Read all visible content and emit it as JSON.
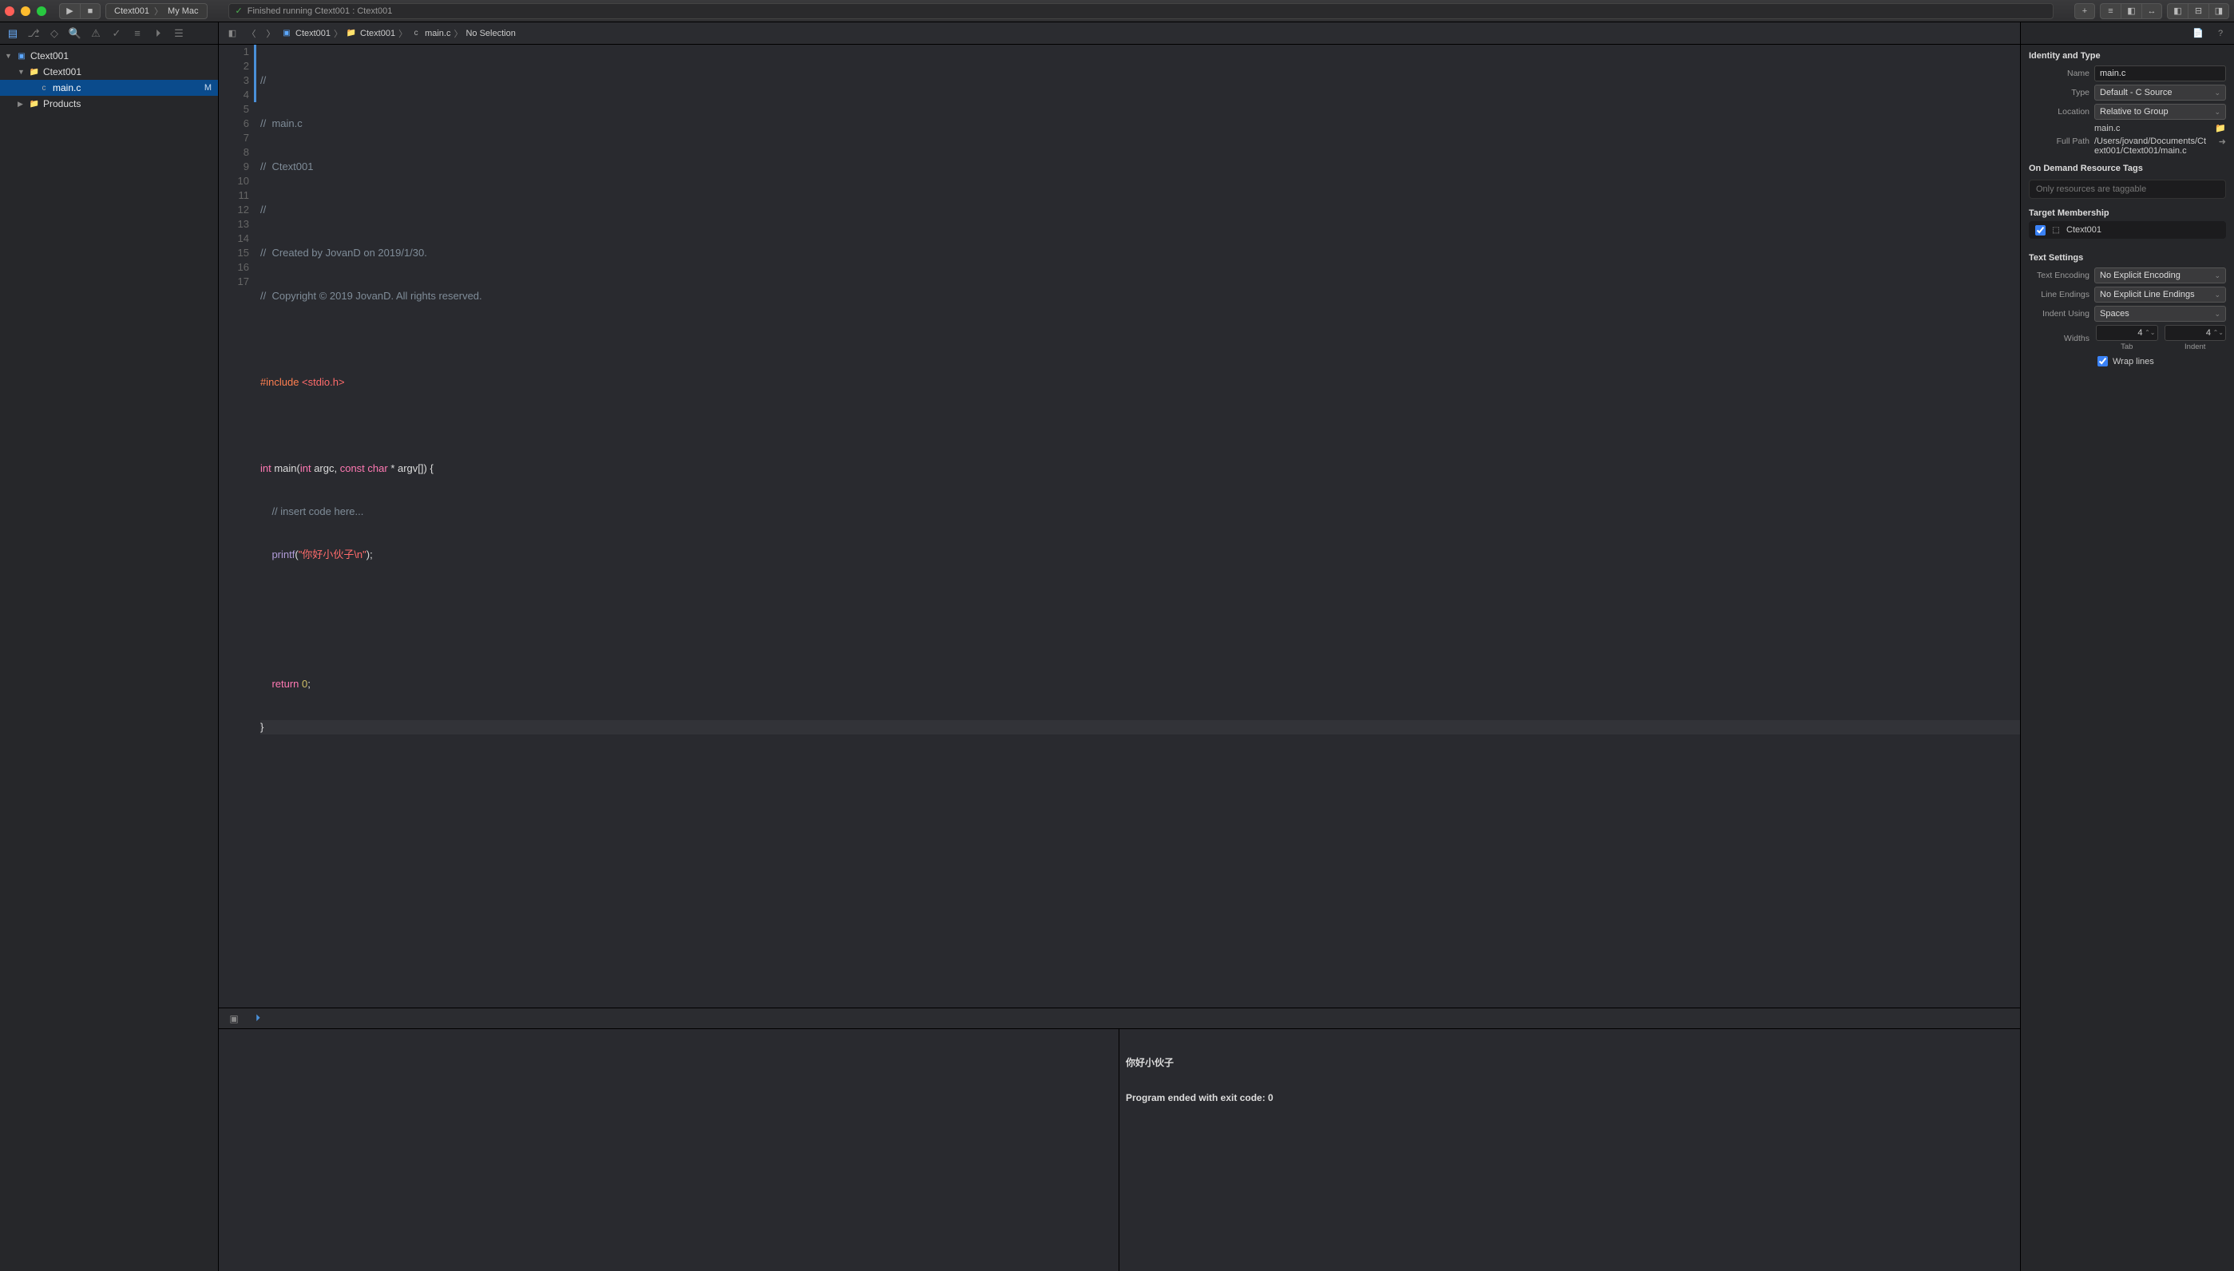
{
  "toolbar": {
    "scheme_project": "Ctext001",
    "scheme_destination": "My Mac",
    "status": "Finished running Ctext001 : Ctext001"
  },
  "navigator": {
    "project": "Ctext001",
    "group": "Ctext001",
    "file": "main.c",
    "file_badge": "M",
    "products": "Products"
  },
  "jumpbar": {
    "proj": "Ctext001",
    "group": "Ctext001",
    "file": "main.c",
    "selection": "No Selection"
  },
  "code": {
    "l1": "//",
    "l2": "//  main.c",
    "l3": "//  Ctext001",
    "l4": "//",
    "l5": "//  Created by JovanD on 2019/1/30.",
    "l6": "//  Copyright © 2019 JovanD. All rights reserved.",
    "l8_pre": "#include ",
    "l8_inc": "<stdio.h>",
    "l10_kw1": "int",
    "l10_fn": " main(",
    "l10_kw2": "int",
    "l10_p1": " argc, ",
    "l10_kw3": "const",
    "l10_p2": " ",
    "l10_kw4": "char",
    "l10_p3": " * argv[]) {",
    "l11": "    // insert code here...",
    "l12_fn": "    printf",
    "l12_p1": "(",
    "l12_str": "\"你好小伙子\\n\"",
    "l12_p2": ");",
    "l15_kw": "    return",
    "l15_p": " ",
    "l15_num": "0",
    "l15_semi": ";",
    "l16": "}"
  },
  "line_numbers": [
    "1",
    "2",
    "3",
    "4",
    "5",
    "6",
    "7",
    "8",
    "9",
    "10",
    "11",
    "12",
    "13",
    "14",
    "15",
    "16",
    "17"
  ],
  "console": {
    "l1": "你好小伙子",
    "l2": "Program ended with exit code: 0"
  },
  "inspector": {
    "identity_title": "Identity and Type",
    "name_label": "Name",
    "name_value": "main.c",
    "type_label": "Type",
    "type_value": "Default - C Source",
    "location_label": "Location",
    "location_value": "Relative to Group",
    "location_file": "main.c",
    "fullpath_label": "Full Path",
    "fullpath_value": "/Users/jovand/Documents/Ctext001/Ctext001/main.c",
    "odr_title": "On Demand Resource Tags",
    "odr_placeholder": "Only resources are taggable",
    "target_title": "Target Membership",
    "target_name": "Ctext001",
    "text_title": "Text Settings",
    "enc_label": "Text Encoding",
    "enc_value": "No Explicit Encoding",
    "le_label": "Line Endings",
    "le_value": "No Explicit Line Endings",
    "indent_label": "Indent Using",
    "indent_value": "Spaces",
    "widths_label": "Widths",
    "tab_val": "4",
    "tab_sub": "Tab",
    "indent_val": "4",
    "indent_sub": "Indent",
    "wrap_label": "Wrap lines"
  }
}
